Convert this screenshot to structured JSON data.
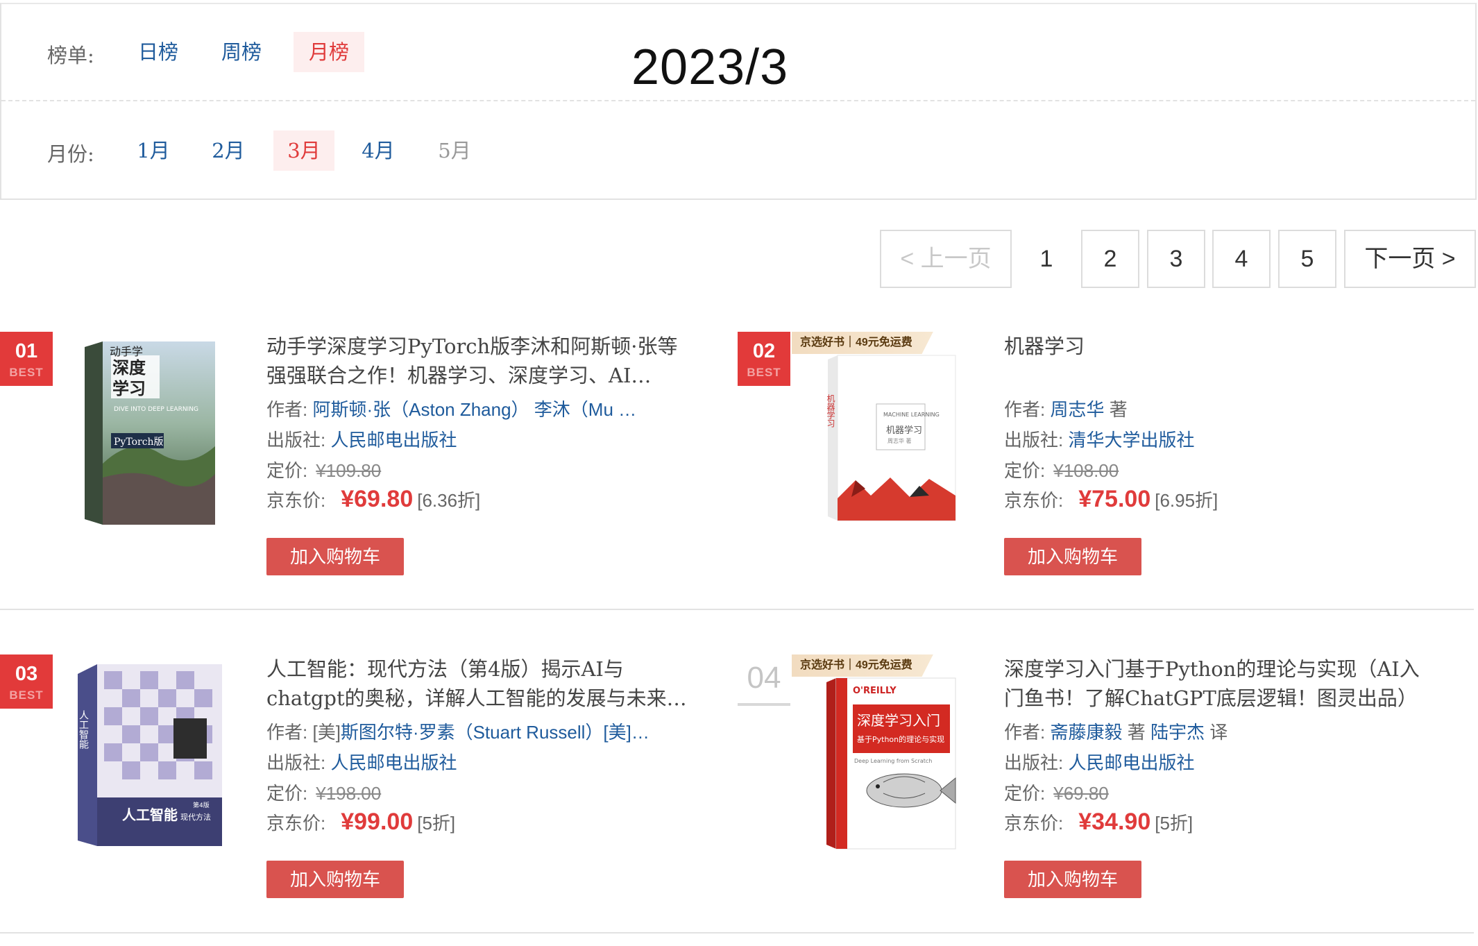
{
  "filter": {
    "list_label": "榜单:",
    "list_options": [
      "日榜",
      "周榜",
      "月榜"
    ],
    "month_label": "月份:",
    "month_options": [
      "1月",
      "2月",
      "3月",
      "4月",
      "5月"
    ],
    "big_title": "2023/3"
  },
  "pagination": {
    "prev": "< 上一页",
    "pages": [
      "1",
      "2",
      "3",
      "4",
      "5"
    ],
    "next": "下一页 >"
  },
  "books": [
    {
      "rank": "01",
      "badge": "BEST",
      "promo": "",
      "title": "动手学深度学习PyTorch版李沐和阿斯顿·张等强强联合之作！机器学习、深度学习、AI…",
      "author_label": "作者:",
      "authors": "阿斯顿·张（Aston Zhang）  李沐（Mu …",
      "author_suffix": "",
      "publisher_label": "出版社:",
      "publisher": "人民邮电出版社",
      "list_price_label": "定价:",
      "list_price": "¥109.80",
      "jd_price_label": "京东价:",
      "jd_price": "¥69.80",
      "discount": "[6.36折]",
      "cart": "加入购物车"
    },
    {
      "rank": "02",
      "badge": "BEST",
      "promo": "京选好书｜49元免运费",
      "title": "机器学习",
      "author_label": "作者:",
      "authors": "周志华",
      "author_suffix": "著",
      "publisher_label": "出版社:",
      "publisher": "清华大学出版社",
      "list_price_label": "定价:",
      "list_price": "¥108.00",
      "jd_price_label": "京东价:",
      "jd_price": "¥75.00",
      "discount": "[6.95折]",
      "cart": "加入购物车"
    },
    {
      "rank": "03",
      "badge": "BEST",
      "promo": "",
      "title": "人工智能：现代方法（第4版）揭示AI与chatgpt的奥秘，详解人工智能的发展与未来…",
      "author_label": "作者:",
      "author_prefix": "[美]",
      "authors": "斯图尔特·罗素（Stuart Russell）[美]…",
      "author_suffix": "",
      "publisher_label": "出版社:",
      "publisher": "人民邮电出版社",
      "list_price_label": "定价:",
      "list_price": "¥198.00",
      "jd_price_label": "京东价:",
      "jd_price": "¥99.00",
      "discount": "[5折]",
      "cart": "加入购物车"
    },
    {
      "rank": "04",
      "badge": "",
      "promo": "京选好书｜49元免运费",
      "title": "深度学习入门基于Python的理论与实现（AI入门鱼书！了解ChatGPT底层逻辑！图灵出品）",
      "author_label": "作者:",
      "authors": "斋藤康毅",
      "author_suffix": "著",
      "author2": "陆宇杰",
      "author2_suffix": "译",
      "publisher_label": "出版社:",
      "publisher": "人民邮电出版社",
      "list_price_label": "定价:",
      "list_price": "¥69.80",
      "jd_price_label": "京东价:",
      "jd_price": "¥34.90",
      "discount": "[5折]",
      "cart": "加入购物车"
    }
  ],
  "covers": {
    "b1": {
      "small": "动手学",
      "main": "深度学习",
      "en": "DIVE INTO DEEP LEARNING",
      "ed": "PyTorch版"
    },
    "b2": {
      "spine": "机器学习",
      "en": "MACHINE LEARNING",
      "cn": "机器学习",
      "author": "周志华 著"
    },
    "b3": {
      "main": "人工智能",
      "sub": "现代方法",
      "ed": "第4版"
    },
    "b4": {
      "brand": "O'REILLY",
      "main": "深度学习入门",
      "sub": "基于Python的理论与实现",
      "en": "Deep Learning from Scratch"
    }
  },
  "colors": {
    "accent": "#e23a3a",
    "link": "#1f5b9c",
    "price": "#e03b3b",
    "cart_bg": "#d9534f"
  }
}
